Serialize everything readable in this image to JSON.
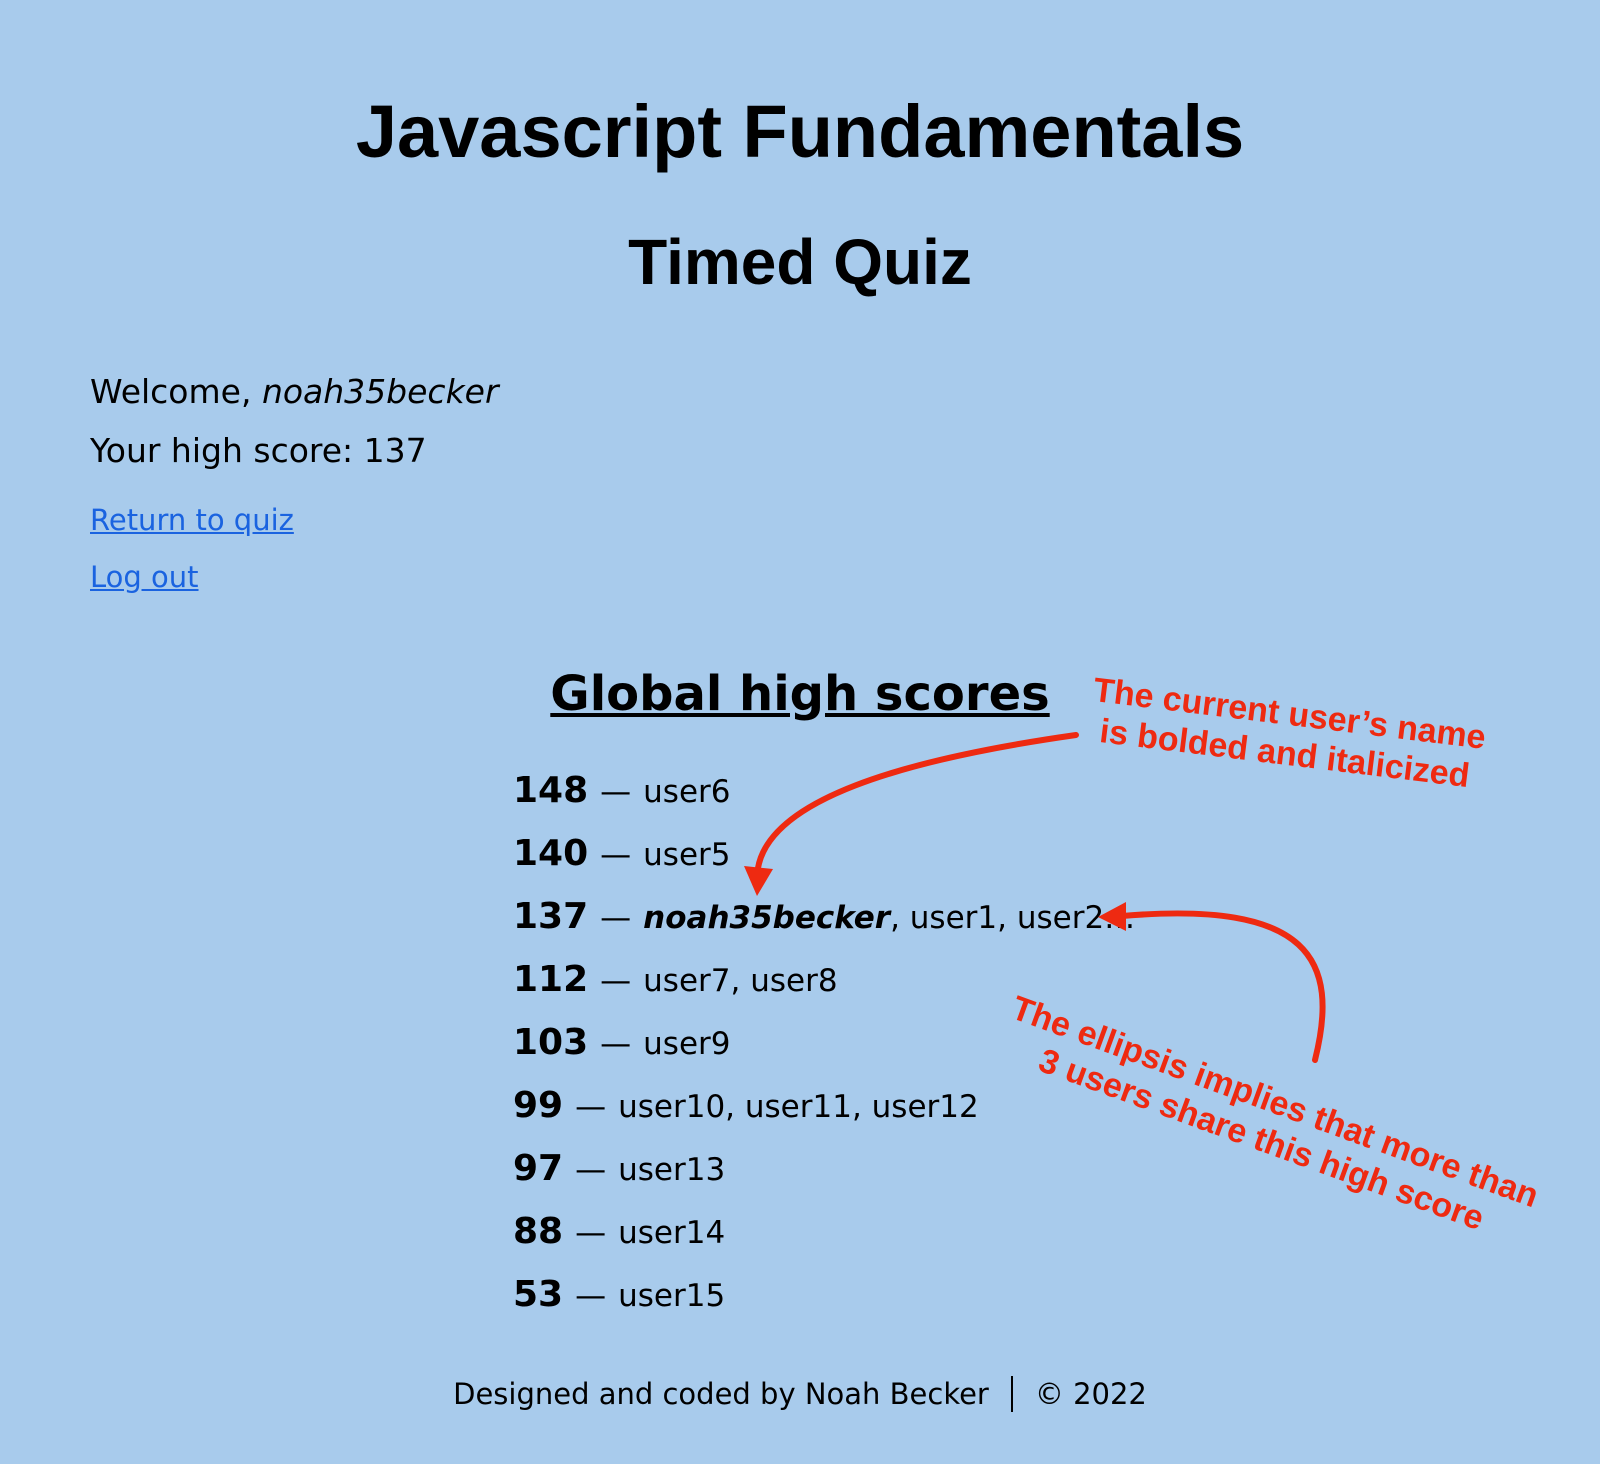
{
  "header": {
    "title": "Javascript Fundamentals",
    "subtitle": "Timed Quiz"
  },
  "user": {
    "welcome_label": "Welcome, ",
    "username": "noah35becker",
    "high_score_label": "Your high score: ",
    "high_score": "137"
  },
  "nav": {
    "return_link": "Return to quiz",
    "logout_link": "Log out"
  },
  "scores": {
    "heading": "Global high scores",
    "separator": "—",
    "rows": [
      {
        "score": "148",
        "users": "user6"
      },
      {
        "score": "140",
        "users": "user5"
      },
      {
        "score": "137",
        "current_user": "noah35becker",
        "users": ", user1, user2…"
      },
      {
        "score": "112",
        "users": "user7, user8"
      },
      {
        "score": "103",
        "users": "user9"
      },
      {
        "score": "99",
        "users": "user10, user11, user12"
      },
      {
        "score": "97",
        "users": "user13"
      },
      {
        "score": "88",
        "users": "user14"
      },
      {
        "score": "53",
        "users": "user15"
      }
    ]
  },
  "footer": {
    "credit": "Designed and coded by Noah Becker",
    "copyright": "© 2022"
  },
  "annotations": {
    "note1": {
      "line1": "The current user’s name",
      "line2": "is bolded and italicized"
    },
    "note2": {
      "line1": "The ellipsis implies that more than",
      "line2": "3 users share this high score"
    },
    "color": "#ee2a11"
  },
  "colors": {
    "background": "#a8cbec",
    "link": "#1a63e0"
  }
}
